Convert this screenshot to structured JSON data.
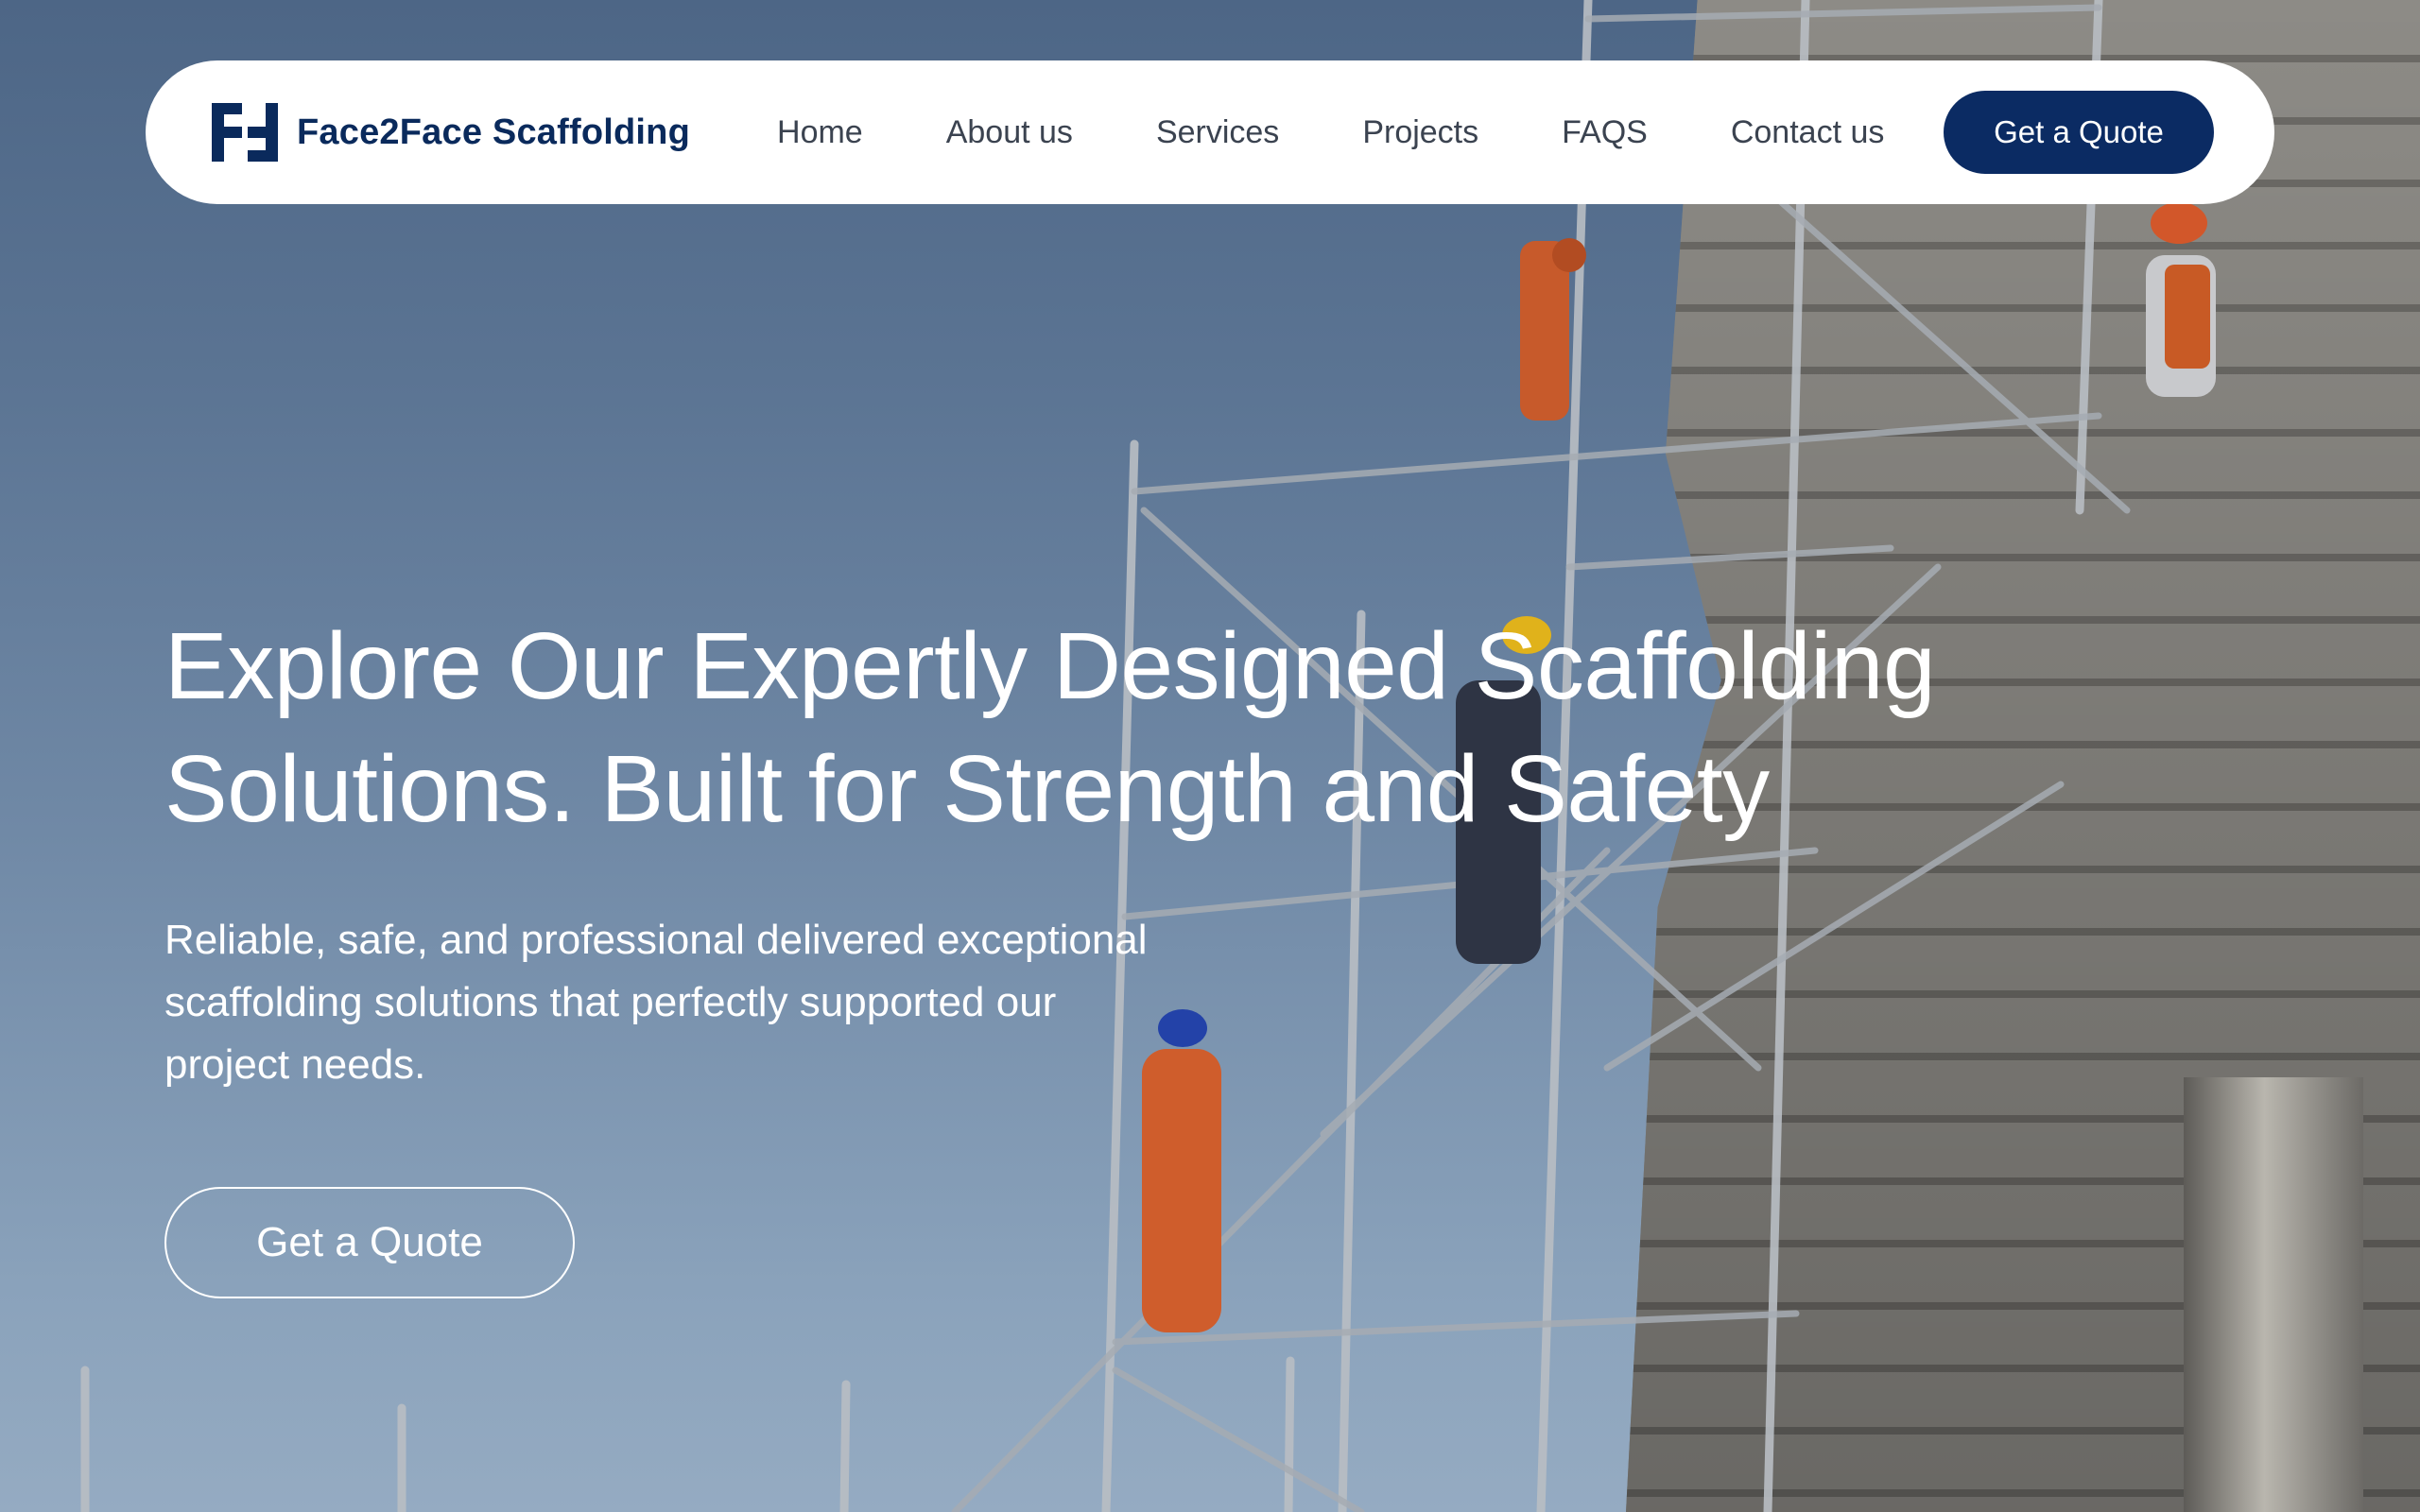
{
  "brand": {
    "name": "Face2Face Scaffolding",
    "logo_icon": "f2f-logo-icon",
    "color": "#0a2a5c"
  },
  "nav": {
    "links": [
      {
        "label": "Home"
      },
      {
        "label": "About us"
      },
      {
        "label": "Services"
      },
      {
        "label": "Projects"
      },
      {
        "label": "FAQS"
      },
      {
        "label": "Contact us"
      }
    ],
    "cta_label": "Get a Quote",
    "cta_color": "#0b2b63"
  },
  "hero": {
    "title_line1": "Explore Our Expertly Designed Scaffolding",
    "title_line2": "Solutions. Built for Strength and Safety",
    "subtitle": "Reliable, safe, and professional delivered exceptional scaffolding solutions that perfectly supported our project needs.",
    "cta_label": "Get a Quote",
    "background": "scaffolding-workers-photo"
  }
}
